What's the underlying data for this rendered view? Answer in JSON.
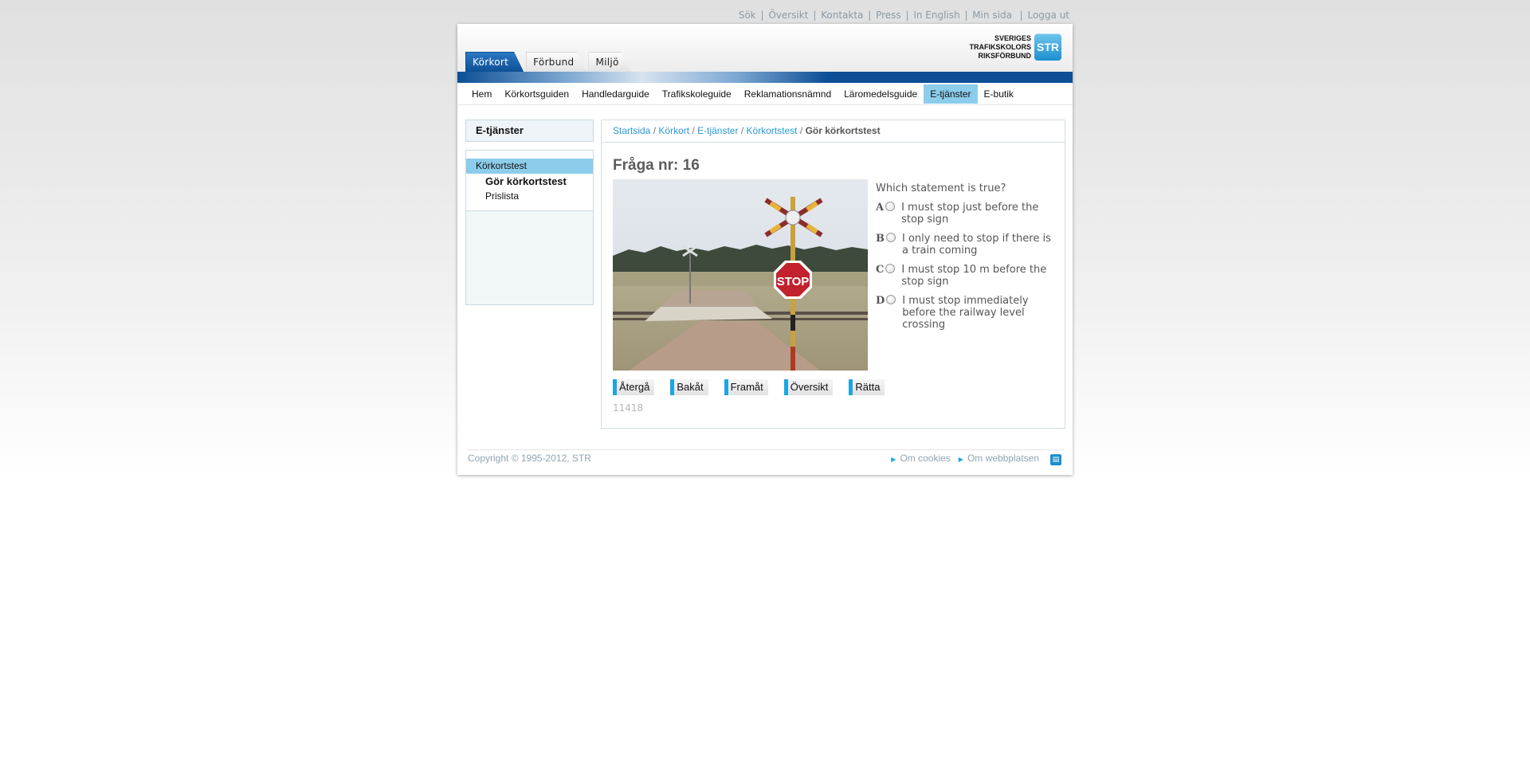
{
  "top_links": [
    "Sök",
    "Översikt",
    "Kontakta",
    "Press",
    "In English",
    "Min sida",
    "Logga ut"
  ],
  "tabs": [
    {
      "label": "Körkort",
      "active": true
    },
    {
      "label": "Förbund",
      "active": false
    },
    {
      "label": "Miljö",
      "active": false
    }
  ],
  "logo": {
    "line1": "SVERIGES",
    "line2": "TRAFIKSKOLORS",
    "line3": "RIKSFÖRBUND",
    "badge": "STR"
  },
  "menu": [
    {
      "label": "Hem"
    },
    {
      "label": "Körkortsguiden"
    },
    {
      "label": "Handledarguide"
    },
    {
      "label": "Trafikskoleguide"
    },
    {
      "label": "Reklamationsnämnd"
    },
    {
      "label": "Läromedelsguide"
    },
    {
      "label": "E-tjänster",
      "active": true
    },
    {
      "label": "E-butik"
    }
  ],
  "sidebar": {
    "title": "E-tjänster",
    "items": [
      {
        "label": "Körkortstest",
        "active": true
      },
      {
        "label": "Gör körkortstest"
      },
      {
        "label": "Prislista"
      }
    ]
  },
  "breadcrumb": {
    "items": [
      "Startsida",
      "Körkort",
      "E-tjänster",
      "Körkortstest"
    ],
    "current": "Gör körkortstest",
    "separator": "/"
  },
  "question": {
    "title": "Fråga nr: 16",
    "text": "Which statement is true?",
    "answers": [
      {
        "letter": "A",
        "text": "I must stop just before the stop sign"
      },
      {
        "letter": "B",
        "text": "I only need to stop if there is a train coming"
      },
      {
        "letter": "C",
        "text": "I must stop 10 m before the stop sign"
      },
      {
        "letter": "D",
        "text": "I must stop immediately before the railway level crossing"
      }
    ],
    "sign_text": "STOP",
    "id": "11418"
  },
  "buttons": [
    "Återgå",
    "Bakåt",
    "Framåt",
    "Översikt",
    "Rätta"
  ],
  "footer": {
    "copyright": "Copyright © 1995-2012, STR",
    "links": [
      "Om cookies",
      "Om webbplatsen"
    ]
  },
  "colors": {
    "accent_blue": "#1ca6e0",
    "dark_blue": "#0d4f96",
    "highlight": "#8ccdec",
    "link": "#2a9ad8"
  }
}
